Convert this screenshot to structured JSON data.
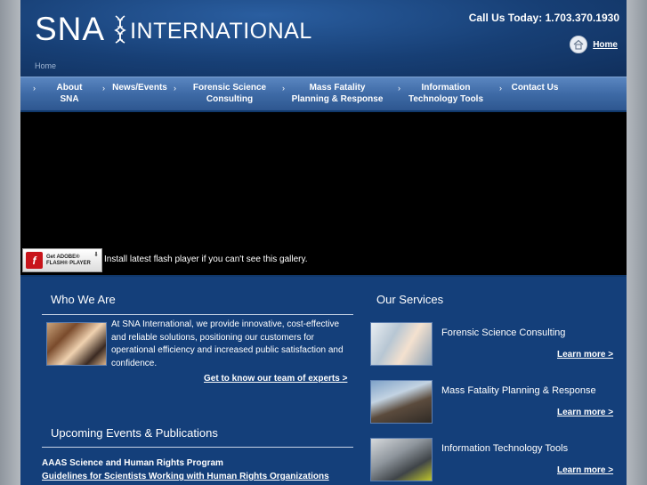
{
  "header": {
    "logo_sna": "SNA",
    "logo_international": "INTERNATIONAL",
    "call_label": "Call Us Today:",
    "phone": "1.703.370.1930",
    "home_label": "Home",
    "breadcrumb": "Home"
  },
  "nav": {
    "items": [
      {
        "line1": "About SNA",
        "line2": ""
      },
      {
        "line1": "News/Events",
        "line2": ""
      },
      {
        "line1": "Forensic Science",
        "line2": "Consulting"
      },
      {
        "line1": "Mass Fatality",
        "line2": "Planning & Response"
      },
      {
        "line1": "Information",
        "line2": "Technology Tools"
      },
      {
        "line1": "Contact Us",
        "line2": ""
      }
    ],
    "bullet": "›"
  },
  "flash": {
    "badge_line1": "Get ADOBE®",
    "badge_line2": "FLASH® PLAYER",
    "message": "Install latest flash player if you can't see this gallery."
  },
  "who": {
    "title": "Who We Are",
    "text": "At SNA  International, we provide  innovative, cost-effective and reliable solutions, positioning our customers for operational efficiency and increased public satisfaction and confidence.",
    "link": "Get to know our team of experts >"
  },
  "events": {
    "title": "Upcoming Events & Publications",
    "item_title": "AAAS Science and Human Rights Program",
    "item_link": "Guidelines for Scientists Working with Human Rights Organizations"
  },
  "services": {
    "title": "Our Services",
    "items": [
      {
        "label": "Forensic Science Consulting",
        "link": "Learn more >"
      },
      {
        "label": "Mass Fatality Planning & Response",
        "link": "Learn more >"
      },
      {
        "label": "Information Technology Tools",
        "link": "Learn more >"
      }
    ]
  }
}
